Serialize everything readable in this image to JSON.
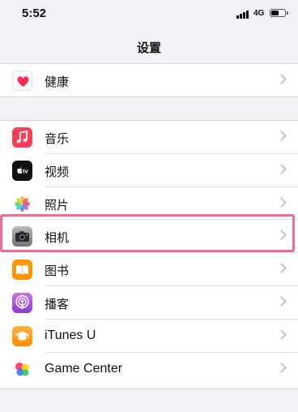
{
  "status_bar": {
    "time": "5:52",
    "network": "4G",
    "battery_level": 0.55,
    "signal_bars": 4
  },
  "nav": {
    "title": "设置"
  },
  "highlight_color": "#ee6c97",
  "groups": [
    {
      "items": [
        {
          "label": "健康",
          "icon": "health-icon",
          "color": "#ffffff"
        }
      ]
    },
    {
      "items": [
        {
          "label": "音乐",
          "icon": "music-icon",
          "color": "#fa3f57"
        },
        {
          "label": "视频",
          "icon": "appletv-icon",
          "color": "#111111"
        },
        {
          "label": "照片",
          "icon": "photos-icon",
          "color": "#ffffff"
        },
        {
          "label": "相机",
          "icon": "camera-icon",
          "color": "#8e8e93"
        },
        {
          "label": "图书",
          "icon": "books-icon",
          "color": "#ff9500"
        },
        {
          "label": "播客",
          "icon": "podcasts-icon",
          "color": "#a454db"
        },
        {
          "label": "iTunes U",
          "icon": "itunes-u-icon",
          "color": "#ff9500"
        },
        {
          "label": "Game Center",
          "icon": "game-center-icon",
          "color": "#ffffff"
        }
      ]
    }
  ]
}
